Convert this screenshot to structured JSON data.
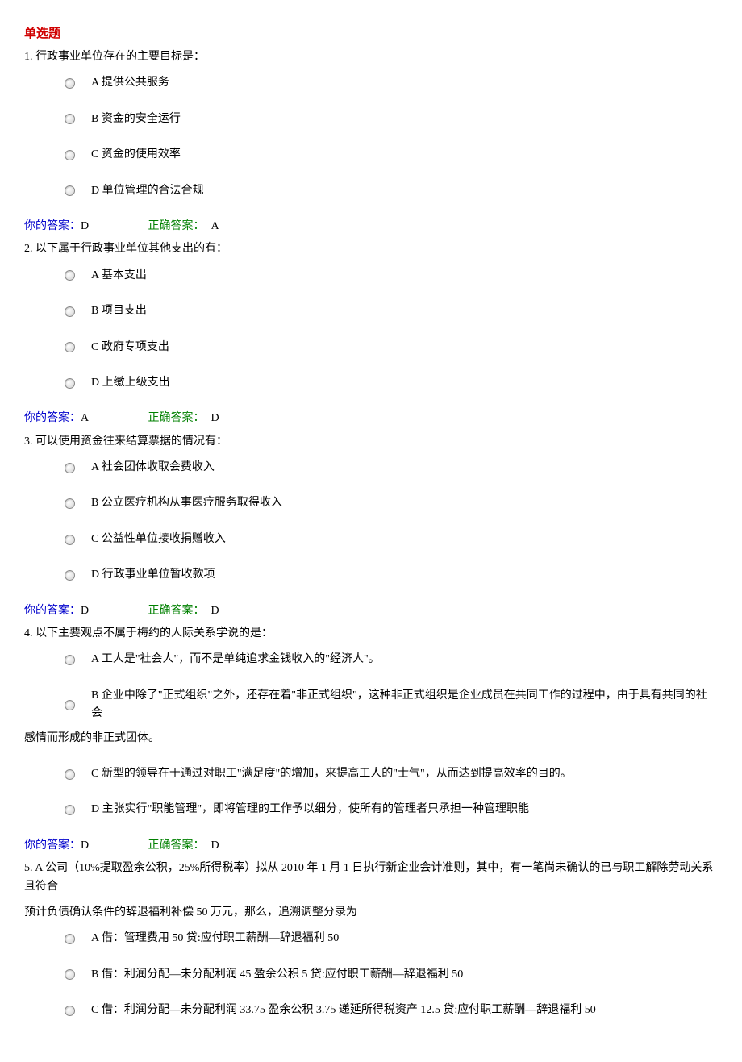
{
  "section_title": "单选题",
  "labels": {
    "your_answer": "你的答案：",
    "correct_answer": "正确答案：",
    "option_prefix": {
      "A": "A",
      "B": "B",
      "C": "C",
      "D": "D"
    }
  },
  "questions": [
    {
      "number": "1.",
      "text": "行政事业单位存在的主要目标是：",
      "options": [
        "A 提供公共服务",
        "B 资金的安全运行",
        "C 资金的使用效率",
        "D 单位管理的合法合规"
      ],
      "your_answer": "D",
      "correct_answer": "A"
    },
    {
      "number": "2.",
      "text": "以下属于行政事业单位其他支出的有：",
      "options": [
        "A 基本支出",
        "B 项目支出",
        "C 政府专项支出",
        "D 上缴上级支出"
      ],
      "your_answer": "A",
      "correct_answer": "D"
    },
    {
      "number": "3.",
      "text": "可以使用资金往来结算票据的情况有：",
      "options": [
        "A 社会团体收取会费收入",
        "B 公立医疗机构从事医疗服务取得收入",
        "C 公益性单位接收捐赠收入",
        "D 行政事业单位暂收款项"
      ],
      "your_answer": "D",
      "correct_answer": "D"
    },
    {
      "number": "4.",
      "text": "以下主要观点不属于梅约的人际关系学说的是：",
      "options": [
        "A 工人是\"社会人\"，而不是单纯追求金钱收入的\"经济人\"。",
        "B 企业中除了\"正式组织\"之外，还存在着\"非正式组织\"，这种非正式组织是企业成员在共同工作的过程中，由于具有共同的社会",
        "C 新型的领导在于通过对职工\"满足度\"的增加，来提高工人的\"士气\"，从而达到提高效率的目的。",
        "D 主张实行\"职能管理\"，即将管理的工作予以细分，使所有的管理者只承担一种管理职能"
      ],
      "option_b_continuation": "感情而形成的非正式团体。",
      "your_answer": "D",
      "correct_answer": "D"
    },
    {
      "number": "5.",
      "text_line1": "A 公司（10%提取盈余公积，25%所得税率）拟从 2010 年 1 月 1 日执行新企业会计准则，其中，有一笔尚未确认的已与职工解除劳动关系且符合",
      "text_line2": "预计负债确认条件的辞退福利补偿 50 万元，那么，追溯调整分录为",
      "options": [
        "A 借：管理费用 50 贷:应付职工薪酬—辞退福利 50",
        "B 借：利润分配—未分配利润 45 盈余公积 5 贷:应付职工薪酬—辞退福利 50",
        "C 借：利润分配—未分配利润 33.75 盈余公积 3.75 递延所得税资产 12.5 贷:应付职工薪酬—辞退福利 50"
      ]
    }
  ]
}
